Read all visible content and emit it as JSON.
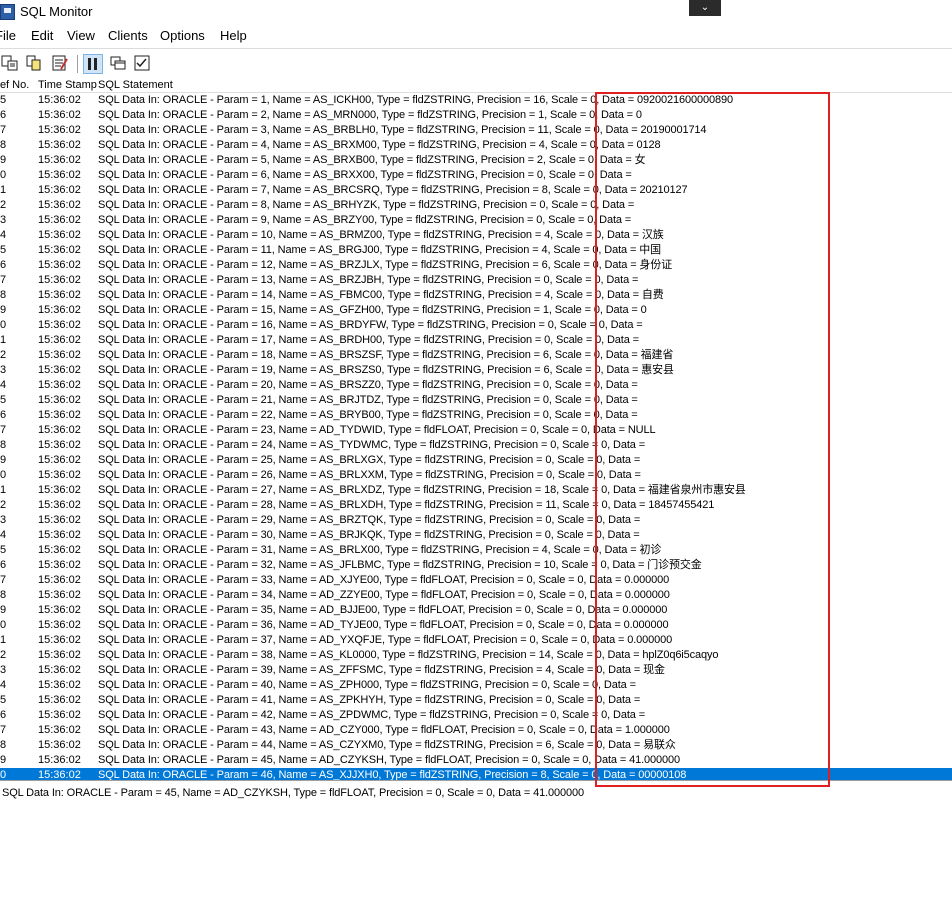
{
  "window": {
    "title": "SQL Monitor",
    "caption_button": "⌄"
  },
  "menu": [
    "File",
    "Edit",
    "View",
    "Clients",
    "Options",
    "Help"
  ],
  "toolbar": {
    "buttons": [
      "save-log",
      "copy",
      "clear-log",
      "pause",
      "windows",
      "options"
    ]
  },
  "list": {
    "columns": [
      "Ref No.",
      "Time Stamp",
      "SQL Statement"
    ],
    "rows": [
      {
        "ref": "5",
        "time": "15:36:02",
        "sql": "SQL Data In: ORACLE - Param = 1, Name = AS_ICKH00, Type = fldZSTRING, Precision = 16, Scale = 0, Data = 0920021600000890"
      },
      {
        "ref": "6",
        "time": "15:36:02",
        "sql": "SQL Data In: ORACLE - Param = 2, Name = AS_MRN000, Type = fldZSTRING, Precision = 1, Scale = 0, Data = 0"
      },
      {
        "ref": "7",
        "time": "15:36:02",
        "sql": "SQL Data In: ORACLE - Param = 3, Name = AS_BRBLH0, Type = fldZSTRING, Precision = 11, Scale = 0, Data = 20190001714"
      },
      {
        "ref": "8",
        "time": "15:36:02",
        "sql": "SQL Data In: ORACLE - Param = 4, Name = AS_BRXM00, Type = fldZSTRING, Precision = 4, Scale = 0, Data = 0128"
      },
      {
        "ref": "9",
        "time": "15:36:02",
        "sql": "SQL Data In: ORACLE - Param = 5, Name = AS_BRXB00, Type = fldZSTRING, Precision = 2, Scale = 0, Data = 女"
      },
      {
        "ref": "0",
        "time": "15:36:02",
        "sql": "SQL Data In: ORACLE - Param = 6, Name = AS_BRXX00, Type = fldZSTRING, Precision = 0, Scale = 0, Data ="
      },
      {
        "ref": "1",
        "time": "15:36:02",
        "sql": "SQL Data In: ORACLE - Param = 7, Name = AS_BRCSRQ, Type = fldZSTRING, Precision = 8, Scale = 0, Data = 20210127"
      },
      {
        "ref": "2",
        "time": "15:36:02",
        "sql": "SQL Data In: ORACLE - Param = 8, Name = AS_BRHYZK, Type = fldZSTRING, Precision = 0, Scale = 0, Data ="
      },
      {
        "ref": "3",
        "time": "15:36:02",
        "sql": "SQL Data In: ORACLE - Param = 9, Name = AS_BRZY00, Type = fldZSTRING, Precision = 0, Scale = 0, Data ="
      },
      {
        "ref": "4",
        "time": "15:36:02",
        "sql": "SQL Data In: ORACLE - Param = 10, Name = AS_BRMZ00, Type = fldZSTRING, Precision = 4, Scale = 0, Data = 汉族"
      },
      {
        "ref": "5",
        "time": "15:36:02",
        "sql": "SQL Data In: ORACLE - Param = 11, Name = AS_BRGJ00, Type = fldZSTRING, Precision = 4, Scale = 0, Data = 中国"
      },
      {
        "ref": "6",
        "time": "15:36:02",
        "sql": "SQL Data In: ORACLE - Param = 12, Name = AS_BRZJLX, Type = fldZSTRING, Precision = 6, Scale = 0, Data = 身份证"
      },
      {
        "ref": "7",
        "time": "15:36:02",
        "sql": "SQL Data In: ORACLE - Param = 13, Name = AS_BRZJBH, Type = fldZSTRING, Precision = 0, Scale = 0, Data ="
      },
      {
        "ref": "8",
        "time": "15:36:02",
        "sql": "SQL Data In: ORACLE - Param = 14, Name = AS_FBMC00, Type = fldZSTRING, Precision = 4, Scale = 0, Data = 自费"
      },
      {
        "ref": "9",
        "time": "15:36:02",
        "sql": "SQL Data In: ORACLE - Param = 15, Name = AS_GFZH00, Type = fldZSTRING, Precision = 1, Scale = 0, Data = 0"
      },
      {
        "ref": "0",
        "time": "15:36:02",
        "sql": "SQL Data In: ORACLE - Param = 16, Name = AS_BRDYFW, Type = fldZSTRING, Precision = 0, Scale = 0, Data ="
      },
      {
        "ref": "1",
        "time": "15:36:02",
        "sql": "SQL Data In: ORACLE - Param = 17, Name = AS_BRDH00, Type = fldZSTRING, Precision = 0, Scale = 0, Data ="
      },
      {
        "ref": "2",
        "time": "15:36:02",
        "sql": "SQL Data In: ORACLE - Param = 18, Name = AS_BRSZSF, Type = fldZSTRING, Precision = 6, Scale = 0, Data = 福建省"
      },
      {
        "ref": "3",
        "time": "15:36:02",
        "sql": "SQL Data In: ORACLE - Param = 19, Name = AS_BRSZS0, Type = fldZSTRING, Precision = 6, Scale = 0, Data = 惠安县"
      },
      {
        "ref": "4",
        "time": "15:36:02",
        "sql": "SQL Data In: ORACLE - Param = 20, Name = AS_BRSZZ0, Type = fldZSTRING, Precision = 0, Scale = 0, Data ="
      },
      {
        "ref": "5",
        "time": "15:36:02",
        "sql": "SQL Data In: ORACLE - Param = 21, Name = AS_BRJTDZ, Type = fldZSTRING, Precision = 0, Scale = 0, Data ="
      },
      {
        "ref": "6",
        "time": "15:36:02",
        "sql": "SQL Data In: ORACLE - Param = 22, Name = AS_BRYB00, Type = fldZSTRING, Precision = 0, Scale = 0, Data ="
      },
      {
        "ref": "7",
        "time": "15:36:02",
        "sql": "SQL Data In: ORACLE - Param = 23, Name = AD_TYDWID, Type = fldFLOAT, Precision = 0, Scale = 0, Data = NULL"
      },
      {
        "ref": "8",
        "time": "15:36:02",
        "sql": "SQL Data In: ORACLE - Param = 24, Name = AS_TYDWMC, Type = fldZSTRING, Precision = 0, Scale = 0, Data ="
      },
      {
        "ref": "9",
        "time": "15:36:02",
        "sql": "SQL Data In: ORACLE - Param = 25, Name = AS_BRLXGX, Type = fldZSTRING, Precision = 0, Scale = 0, Data ="
      },
      {
        "ref": "0",
        "time": "15:36:02",
        "sql": "SQL Data In: ORACLE - Param = 26, Name = AS_BRLXXM, Type = fldZSTRING, Precision = 0, Scale = 0, Data ="
      },
      {
        "ref": "1",
        "time": "15:36:02",
        "sql": "SQL Data In: ORACLE - Param = 27, Name = AS_BRLXDZ, Type = fldZSTRING, Precision = 18, Scale = 0, Data = 福建省泉州市惠安县"
      },
      {
        "ref": "2",
        "time": "15:36:02",
        "sql": "SQL Data In: ORACLE - Param = 28, Name = AS_BRLXDH, Type = fldZSTRING, Precision = 11, Scale = 0, Data = 18457455421"
      },
      {
        "ref": "3",
        "time": "15:36:02",
        "sql": "SQL Data In: ORACLE - Param = 29, Name = AS_BRZTQK, Type = fldZSTRING, Precision = 0, Scale = 0, Data ="
      },
      {
        "ref": "4",
        "time": "15:36:02",
        "sql": "SQL Data In: ORACLE - Param = 30, Name = AS_BRJKQK, Type = fldZSTRING, Precision = 0, Scale = 0, Data ="
      },
      {
        "ref": "5",
        "time": "15:36:02",
        "sql": "SQL Data In: ORACLE - Param = 31, Name = AS_BRLX00, Type = fldZSTRING, Precision = 4, Scale = 0, Data = 初诊"
      },
      {
        "ref": "6",
        "time": "15:36:02",
        "sql": "SQL Data In: ORACLE - Param = 32, Name = AS_JFLBMC, Type = fldZSTRING, Precision = 10, Scale = 0, Data = 门诊预交金"
      },
      {
        "ref": "7",
        "time": "15:36:02",
        "sql": "SQL Data In: ORACLE - Param = 33, Name = AD_XJYE00, Type = fldFLOAT, Precision = 0, Scale = 0, Data = 0.000000"
      },
      {
        "ref": "8",
        "time": "15:36:02",
        "sql": "SQL Data In: ORACLE - Param = 34, Name = AD_ZZYE00, Type = fldFLOAT, Precision = 0, Scale = 0, Data = 0.000000"
      },
      {
        "ref": "9",
        "time": "15:36:02",
        "sql": "SQL Data In: ORACLE - Param = 35, Name = AD_BJJE00, Type = fldFLOAT, Precision = 0, Scale = 0, Data = 0.000000"
      },
      {
        "ref": "0",
        "time": "15:36:02",
        "sql": "SQL Data In: ORACLE - Param = 36, Name = AD_TYJE00, Type = fldFLOAT, Precision = 0, Scale = 0, Data = 0.000000"
      },
      {
        "ref": "1",
        "time": "15:36:02",
        "sql": "SQL Data In: ORACLE - Param = 37, Name = AD_YXQFJE, Type = fldFLOAT, Precision = 0, Scale = 0, Data = 0.000000"
      },
      {
        "ref": "2",
        "time": "15:36:02",
        "sql": "SQL Data In: ORACLE - Param = 38, Name = AS_KL0000, Type = fldZSTRING, Precision = 14, Scale = 0, Data = hplZ0q6i5caqyo"
      },
      {
        "ref": "3",
        "time": "15:36:02",
        "sql": "SQL Data In: ORACLE - Param = 39, Name = AS_ZFFSMC, Type = fldZSTRING, Precision = 4, Scale = 0, Data = 现金"
      },
      {
        "ref": "4",
        "time": "15:36:02",
        "sql": "SQL Data In: ORACLE - Param = 40, Name = AS_ZPH000, Type = fldZSTRING, Precision = 0, Scale = 0, Data ="
      },
      {
        "ref": "5",
        "time": "15:36:02",
        "sql": "SQL Data In: ORACLE - Param = 41, Name = AS_ZPKHYH, Type = fldZSTRING, Precision = 0, Scale = 0, Data ="
      },
      {
        "ref": "6",
        "time": "15:36:02",
        "sql": "SQL Data In: ORACLE - Param = 42, Name = AS_ZPDWMC, Type = fldZSTRING, Precision = 0, Scale = 0, Data ="
      },
      {
        "ref": "7",
        "time": "15:36:02",
        "sql": "SQL Data In: ORACLE - Param = 43, Name = AD_CZY000, Type = fldFLOAT, Precision = 0, Scale = 0, Data = 1.000000"
      },
      {
        "ref": "8",
        "time": "15:36:02",
        "sql": "SQL Data In: ORACLE - Param = 44, Name = AS_CZYXM0, Type = fldZSTRING, Precision = 6, Scale = 0, Data = 易联众"
      },
      {
        "ref": "9",
        "time": "15:36:02",
        "sql": "SQL Data In: ORACLE - Param = 45, Name = AD_CZYKSH, Type = fldFLOAT, Precision = 0, Scale = 0, Data = 41.000000"
      },
      {
        "ref": "0",
        "time": "15:36:02",
        "sql": "SQL Data In: ORACLE - Param = 46, Name = AS_XJJXH0, Type = fldZSTRING, Precision = 8, Scale = 0, Data = 00000108"
      }
    ],
    "selected_index": 45
  },
  "detail": {
    "text": "SQL Data In: ORACLE - Param = 45, Name = AD_CZYKSH, Type = fldFLOAT, Precision = 0, Scale = 0, Data = 41.000000"
  },
  "colors": {
    "selection": "#0078d7",
    "annotation_border": "#e02020"
  }
}
